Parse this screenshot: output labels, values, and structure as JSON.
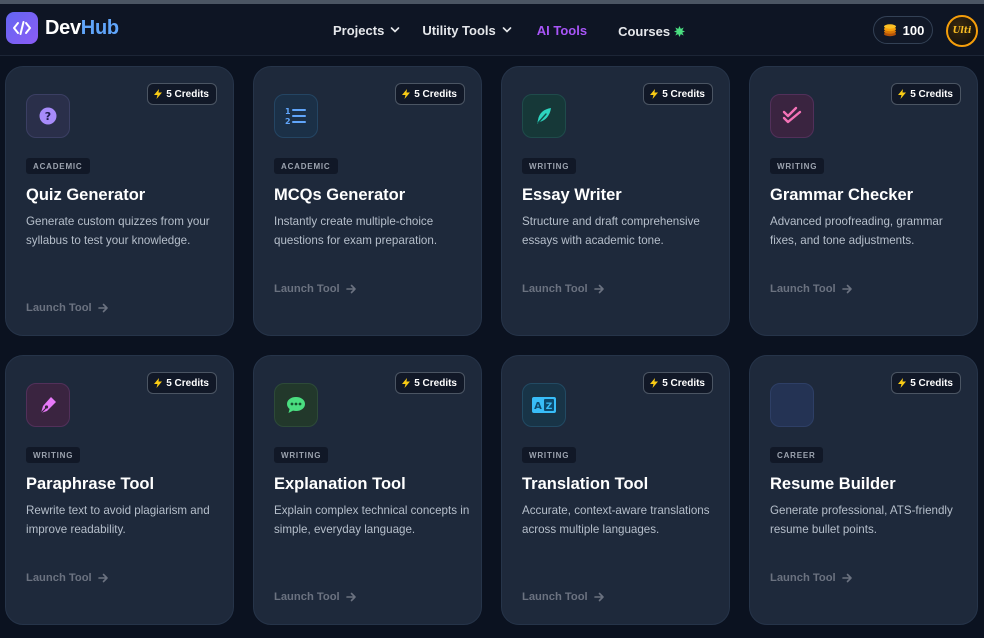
{
  "app": {
    "name_part1": "Dev",
    "name_part2": "Hub"
  },
  "nav": {
    "projects": "Projects",
    "utility_tools": "Utility Tools",
    "ai_tools": "AI Tools",
    "courses": "Courses"
  },
  "user": {
    "credits": "100",
    "avatar_text": "Ulti"
  },
  "colors": {
    "accent_purple": "#a855f7",
    "brand_blue": "#60a5fa",
    "card_bg": "#1e293b",
    "page_bg": "#0b1220"
  },
  "tools": [
    {
      "credits": "5 Credits",
      "tag": "ACADEMIC",
      "title": "Quiz Generator",
      "desc": "Generate custom quizzes from your syllabus to test your knowledge.",
      "launch": "Launch Tool",
      "icon": "question-icon"
    },
    {
      "credits": "5 Credits",
      "tag": "ACADEMIC",
      "title": "MCQs Generator",
      "desc": "Instantly create multiple-choice questions for exam preparation.",
      "launch": "Launch Tool",
      "icon": "numbered-list-icon"
    },
    {
      "credits": "5 Credits",
      "tag": "WRITING",
      "title": "Essay Writer",
      "desc": "Structure and draft comprehensive essays with academic tone.",
      "launch": "Launch Tool",
      "icon": "feather-icon"
    },
    {
      "credits": "5 Credits",
      "tag": "WRITING",
      "title": "Grammar Checker",
      "desc": "Advanced proofreading, grammar fixes, and tone adjustments.",
      "launch": "Launch Tool",
      "icon": "double-check-icon"
    },
    {
      "credits": "5 Credits",
      "tag": "WRITING",
      "title": "Paraphrase Tool",
      "desc": "Rewrite text to avoid plagiarism and improve readability.",
      "launch": "Launch Tool",
      "icon": "pen-nib-icon"
    },
    {
      "credits": "5 Credits",
      "tag": "WRITING",
      "title": "Explanation Tool",
      "desc": "Explain complex technical concepts in simple, everyday language.",
      "launch": "Launch Tool",
      "icon": "chat-bubble-icon"
    },
    {
      "credits": "5 Credits",
      "tag": "WRITING",
      "title": "Translation Tool",
      "desc": "Accurate, context-aware translations across multiple languages.",
      "launch": "Launch Tool",
      "icon": "translate-icon"
    },
    {
      "credits": "5 Credits",
      "tag": "CAREER",
      "title": "Resume Builder",
      "desc": "Generate professional, ATS-friendly resume bullet points.",
      "launch": "Launch Tool",
      "icon": "resume-icon"
    }
  ]
}
